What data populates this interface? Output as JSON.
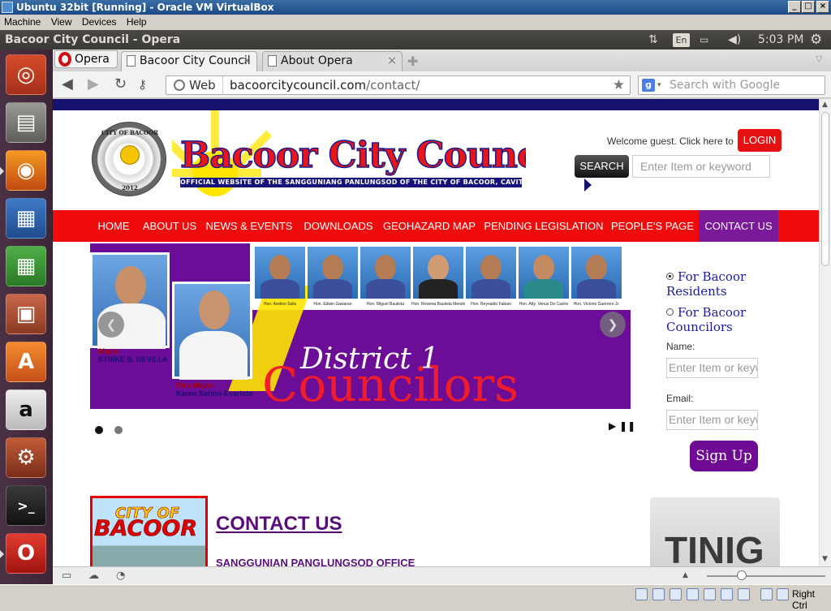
{
  "vbox": {
    "title": "Ubuntu 32bit [Running] - Oracle VM VirtualBox",
    "menu": [
      "Machine",
      "View",
      "Devices",
      "Help"
    ],
    "host_key": "Right Ctrl"
  },
  "ubuntu_panel": {
    "window_title": "Bacoor City Council - Opera",
    "keyboard_layout": "En",
    "clock": "5:03 PM"
  },
  "launcher": {
    "items": [
      "dash-home",
      "files",
      "firefox",
      "libreoffice-writer",
      "libreoffice-calc",
      "libreoffice-impress",
      "ubuntu-software-center",
      "amazon",
      "system-settings",
      "terminal",
      "opera"
    ]
  },
  "browser": {
    "menu_label": "Opera",
    "tabs": [
      {
        "label": "Bacoor City Council",
        "active": true
      },
      {
        "label": "About Opera",
        "active": false
      }
    ],
    "address": {
      "badge": "Web",
      "host": "bacoorcitycouncil.com",
      "path": "/contact/"
    },
    "search_placeholder": "Search with Google"
  },
  "site": {
    "seal": {
      "top": "CITY OF BACOOR",
      "year": "2012"
    },
    "brand": "Bacoor City Council",
    "tagline": "OFFICIAL WEBSITE OF THE SANGGUNIANG PANLUNGSOD OF THE CITY OF BACOOR, CAVITE",
    "welcome": "Welcome guest. Click here to",
    "login": "LOGIN",
    "search_button": "SEARCH",
    "search_placeholder": "Enter Item or keyword",
    "nav": [
      "HOME",
      "ABOUT US",
      "NEWS & EVENTS",
      "DOWNLOADS",
      "GEOHAZARD MAP",
      "PENDING LEGISLATION",
      "PEOPLE'S PAGE",
      "CONTACT US"
    ],
    "nav_active": "CONTACT US",
    "slider": {
      "mayor_role": "Mayor",
      "mayor_name": "STRIKE B. REVILLA",
      "vice_role": "Vice Mayor",
      "vice_name": "Karen Sarino-Evaristo",
      "councilors": [
        "Hon. Avelino Solis",
        "Hon. Edwin Gawaran",
        "Hon. Miguel Bautista",
        "Hon. Rowena Bautista Mendiola",
        "Hon. Reynaldo Fabian",
        "Hon. Atty. Venus De Castro",
        "Hon. Victorio Guerrero Jr."
      ],
      "district": "District 1",
      "councilors_word": "Councilors"
    },
    "subscribe": {
      "option1": "For Bacoor Residents",
      "option2": "For Bacoor Councilors",
      "name_label": "Name:",
      "email_label": "Email:",
      "field_placeholder": "Enter Item or keyword",
      "signup": "Sign Up"
    },
    "city_image": {
      "line1": "CITY OF",
      "line2": "BACOOR"
    },
    "contact_title": "CONTACT US",
    "office": "SANGGUNIAN PANGLUNGSOD OFFICE",
    "tinig": "TINIG"
  },
  "colors": {
    "nav_red": "#f00c0c",
    "nav_active": "#7a1a9a",
    "slider_purple": "#6b0d96",
    "header_navy": "#17116f",
    "ubuntu_launcher": "#4b3144"
  }
}
